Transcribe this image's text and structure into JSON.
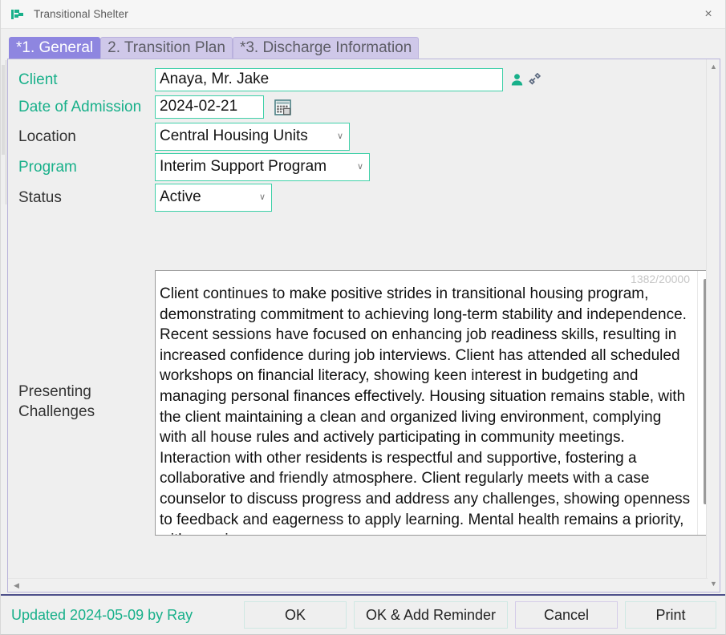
{
  "window": {
    "title": "Transitional Shelter",
    "app_icon": "flag-icon",
    "close_icon": "close-icon",
    "close_label": "×"
  },
  "tabs": [
    {
      "label": "*1. General",
      "active": true
    },
    {
      "label": "2. Transition Plan",
      "active": false
    },
    {
      "label": "*3. Discharge Information",
      "active": false
    }
  ],
  "form": {
    "client": {
      "label": "Client",
      "required": true,
      "value": "Anaya, Mr. Jake",
      "person_icon": "person-icon",
      "link_icon": "link-icon"
    },
    "date_of_admission": {
      "label": "Date of Admission",
      "required": true,
      "value": "2024-02-21",
      "calendar_icon": "calendar-icon"
    },
    "location": {
      "label": "Location",
      "required": false,
      "value": "Central Housing Units",
      "chevron": "∨"
    },
    "program": {
      "label": "Program",
      "required": true,
      "value": "Interim Support Program",
      "chevron": "∨"
    },
    "status": {
      "label": "Status",
      "required": false,
      "value": "Active",
      "chevron": "∨"
    },
    "presenting_challenges": {
      "label": "Presenting Challenges",
      "char_count": "1382/20000",
      "value": "Client continues to make positive strides in transitional housing program, demonstrating commitment to achieving long-term stability and independence. Recent sessions have focused on enhancing job readiness skills, resulting in increased confidence during job interviews. Client has attended all scheduled workshops on financial literacy, showing keen interest in budgeting and managing personal finances effectively. Housing situation remains stable, with the client maintaining a clean and organized living environment, complying with all house rules and actively participating in community meetings. Interaction with other residents is respectful and supportive, fostering a collaborative and friendly atmosphere. Client regularly meets with a case counselor to discuss progress and address any challenges, showing openness to feedback and eagerness to apply learning. Mental health remains a priority, with ongoing"
    }
  },
  "scrollbars": {
    "panel_up_arrow": "▲",
    "panel_down_arrow": "▼",
    "panel_left_arrow": "◀",
    "panel_right_arrow": "▶"
  },
  "footer": {
    "updated_text": "Updated 2024-05-09 by Ray",
    "buttons": [
      {
        "label": "OK",
        "style": "teal"
      },
      {
        "label": "OK & Add Reminder",
        "style": "teal"
      },
      {
        "label": "Cancel",
        "style": "lavender"
      },
      {
        "label": "Print",
        "style": "teal"
      }
    ]
  },
  "colors": {
    "accent_teal": "#18b08a",
    "tab_active": "#8e86e0",
    "tab_inactive": "#cfc8e9",
    "footer_rule": "#4d4f8a",
    "field_border": "#3fd0a8"
  }
}
